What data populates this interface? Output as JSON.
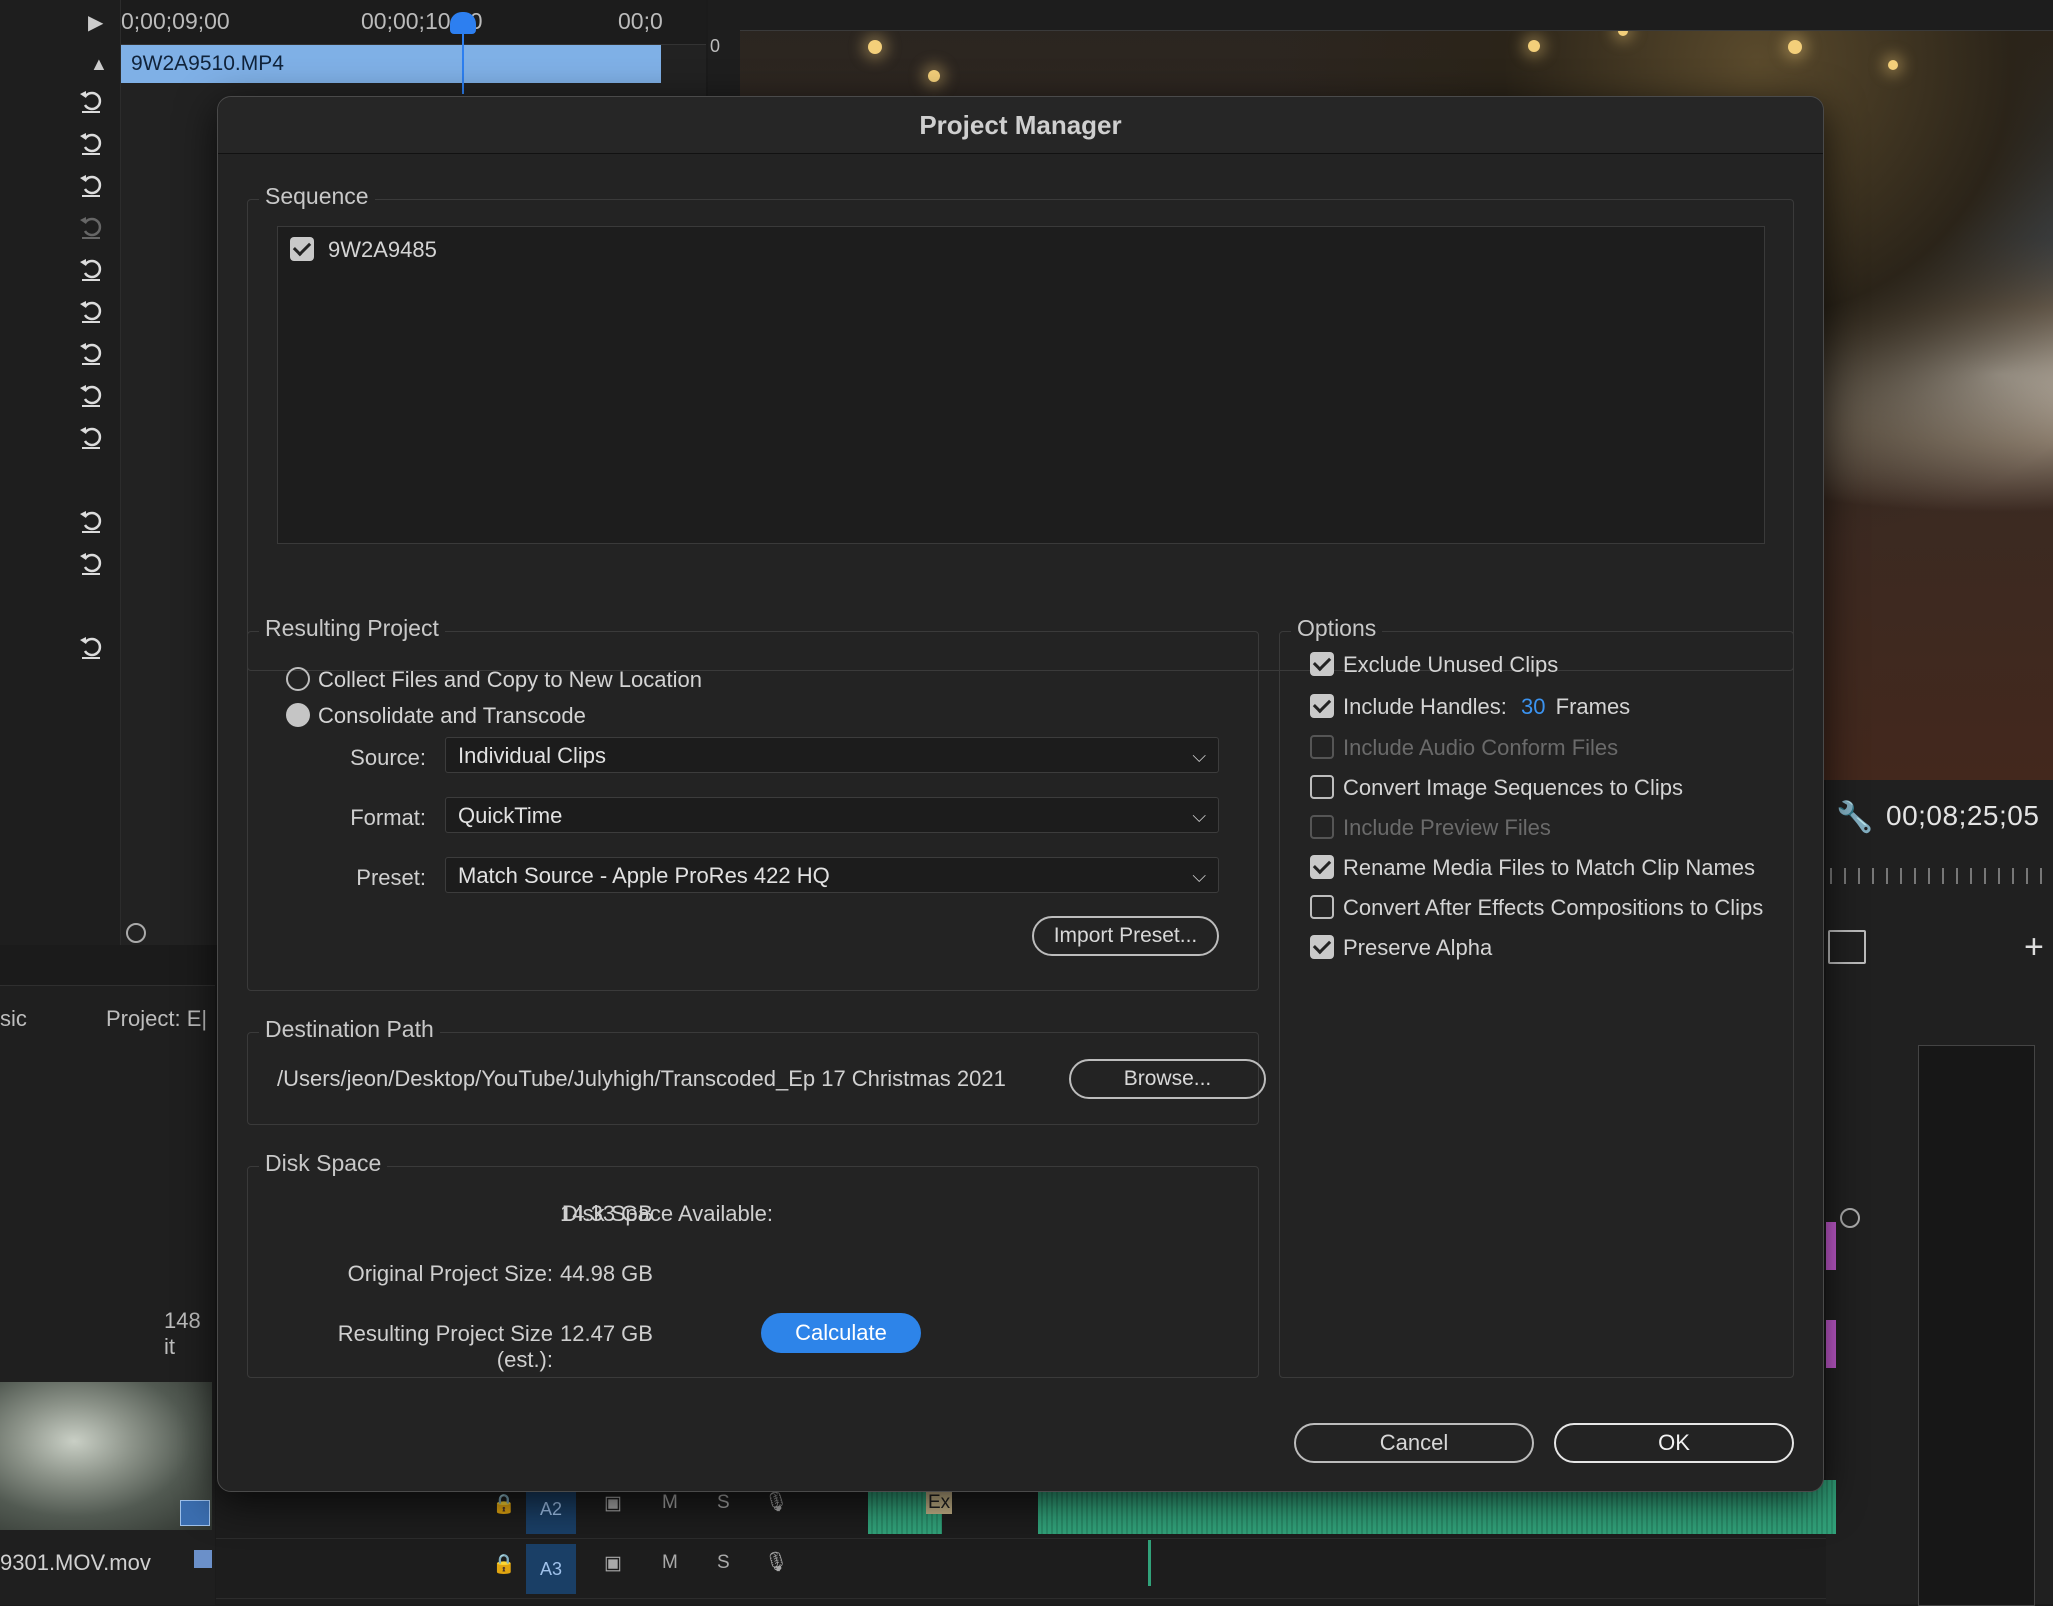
{
  "timeline": {
    "tick_1": "0;00;09;00",
    "tick_2": "00;00;10;00",
    "tick_3": "00;0",
    "clip_name": "9W2A9510.MP4"
  },
  "preview": {
    "ruler_zero": "0",
    "timecode": "00;08;25;05"
  },
  "project_panel": {
    "tab_partial": "sic",
    "tab_project": "Project: E|",
    "items_count": "148 it",
    "thumb_caption": "9301.MOV.mov"
  },
  "tracks": [
    {
      "label": "A2",
      "mute": "M",
      "solo": "S",
      "clip_tag": "Ex"
    },
    {
      "label": "A3",
      "mute": "M",
      "solo": "S"
    }
  ],
  "dialog": {
    "title": "Project Manager",
    "sequence": {
      "legend": "Sequence",
      "items": [
        {
          "name": "9W2A9485",
          "checked": true
        }
      ]
    },
    "resulting_project": {
      "legend": "Resulting Project",
      "collect_label": "Collect Files and Copy to New Location",
      "consolidate_label": "Consolidate and Transcode",
      "source_label": "Source:",
      "source_value": "Individual Clips",
      "format_label": "Format:",
      "format_value": "QuickTime",
      "preset_label": "Preset:",
      "preset_value": "Match Source - Apple ProRes 422 HQ",
      "import_preset": "Import Preset..."
    },
    "options": {
      "legend": "Options",
      "exclude_unused": "Exclude Unused Clips",
      "include_handles": "Include Handles:",
      "handles_value": "30",
      "handles_unit": "Frames",
      "include_audio_conform": "Include Audio Conform Files",
      "convert_image_sequences": "Convert Image Sequences to Clips",
      "include_preview": "Include Preview Files",
      "rename_media": "Rename Media Files to Match Clip Names",
      "convert_ae": "Convert After Effects Compositions to Clips",
      "preserve_alpha": "Preserve Alpha"
    },
    "destination": {
      "legend": "Destination Path",
      "path": "/Users/jeon/Desktop/YouTube/Julyhigh/Transcoded_Ep 17 Christmas 2021",
      "browse": "Browse..."
    },
    "disk_space": {
      "legend": "Disk Space",
      "available_label": "Disk Space Available:",
      "available_value": "14.33 GB",
      "original_label": "Original Project Size:",
      "original_value": "44.98 GB",
      "resulting_label": "Resulting Project Size (est.):",
      "resulting_value": "12.47 GB",
      "calculate": "Calculate"
    },
    "cancel": "Cancel",
    "ok": "OK"
  }
}
